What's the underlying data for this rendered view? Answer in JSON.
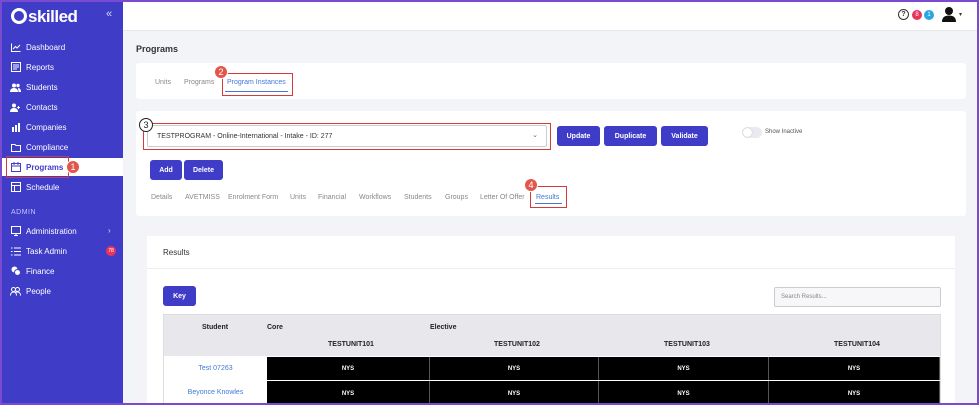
{
  "brand": {
    "logo_text": "skilled",
    "collapse": "«"
  },
  "sidebar": {
    "items": [
      {
        "label": "Dashboard",
        "icon": "chart-line-icon"
      },
      {
        "label": "Reports",
        "icon": "report-icon"
      },
      {
        "label": "Students",
        "icon": "users-icon"
      },
      {
        "label": "Contacts",
        "icon": "contacts-icon"
      },
      {
        "label": "Companies",
        "icon": "building-icon"
      },
      {
        "label": "Compliance",
        "icon": "folder-icon"
      },
      {
        "label": "Programs",
        "icon": "calendar-icon"
      },
      {
        "label": "Schedule",
        "icon": "schedule-icon"
      }
    ],
    "section_admin": "ADMIN",
    "admin_items": [
      {
        "label": "Administration",
        "icon": "monitor-icon"
      },
      {
        "label": "Task Admin",
        "icon": "list-icon",
        "badge": "78"
      },
      {
        "label": "Finance",
        "icon": "coins-icon"
      },
      {
        "label": "People",
        "icon": "people-icon"
      }
    ]
  },
  "topbar": {
    "help": "?",
    "badge1": "8",
    "badge2": "1",
    "caret": "▾"
  },
  "page": {
    "title": "Programs"
  },
  "subtabs": [
    "Units",
    "Programs",
    "Program Instances"
  ],
  "instance": {
    "selected": "TESTPROGRAM - Online-International - Intake - ID: 277",
    "update": "Update",
    "duplicate": "Duplicate",
    "validate": "Validate",
    "show_inactive": "Show Inactive",
    "add": "Add",
    "delete": "Delete"
  },
  "content_tabs": [
    "Details",
    "AVETMISS",
    "Enrolment Form",
    "Units",
    "Financial",
    "Workflows",
    "Students",
    "Groups",
    "Letter Of Offer",
    "Results"
  ],
  "results": {
    "title": "Results",
    "key_button": "Key",
    "search_placeholder": "Search Results...",
    "headers": {
      "student": "Student",
      "core": "Core",
      "elective": "Elective"
    },
    "units": [
      "TESTUNIT101",
      "TESTUNIT102",
      "TESTUNIT103",
      "TESTUNIT104"
    ],
    "rows": [
      {
        "student": "Test 07263",
        "values": [
          "NYS",
          "NYS",
          "NYS",
          "NYS"
        ]
      },
      {
        "student": "Beyonce Knowles",
        "values": [
          "NYS",
          "NYS",
          "NYS",
          "NYS"
        ]
      }
    ]
  },
  "annotations": [
    "1",
    "2",
    "3",
    "4"
  ],
  "colors": {
    "primary": "#3f3cc8",
    "link": "#3f7bd6",
    "annotation": "#d43a3a"
  }
}
